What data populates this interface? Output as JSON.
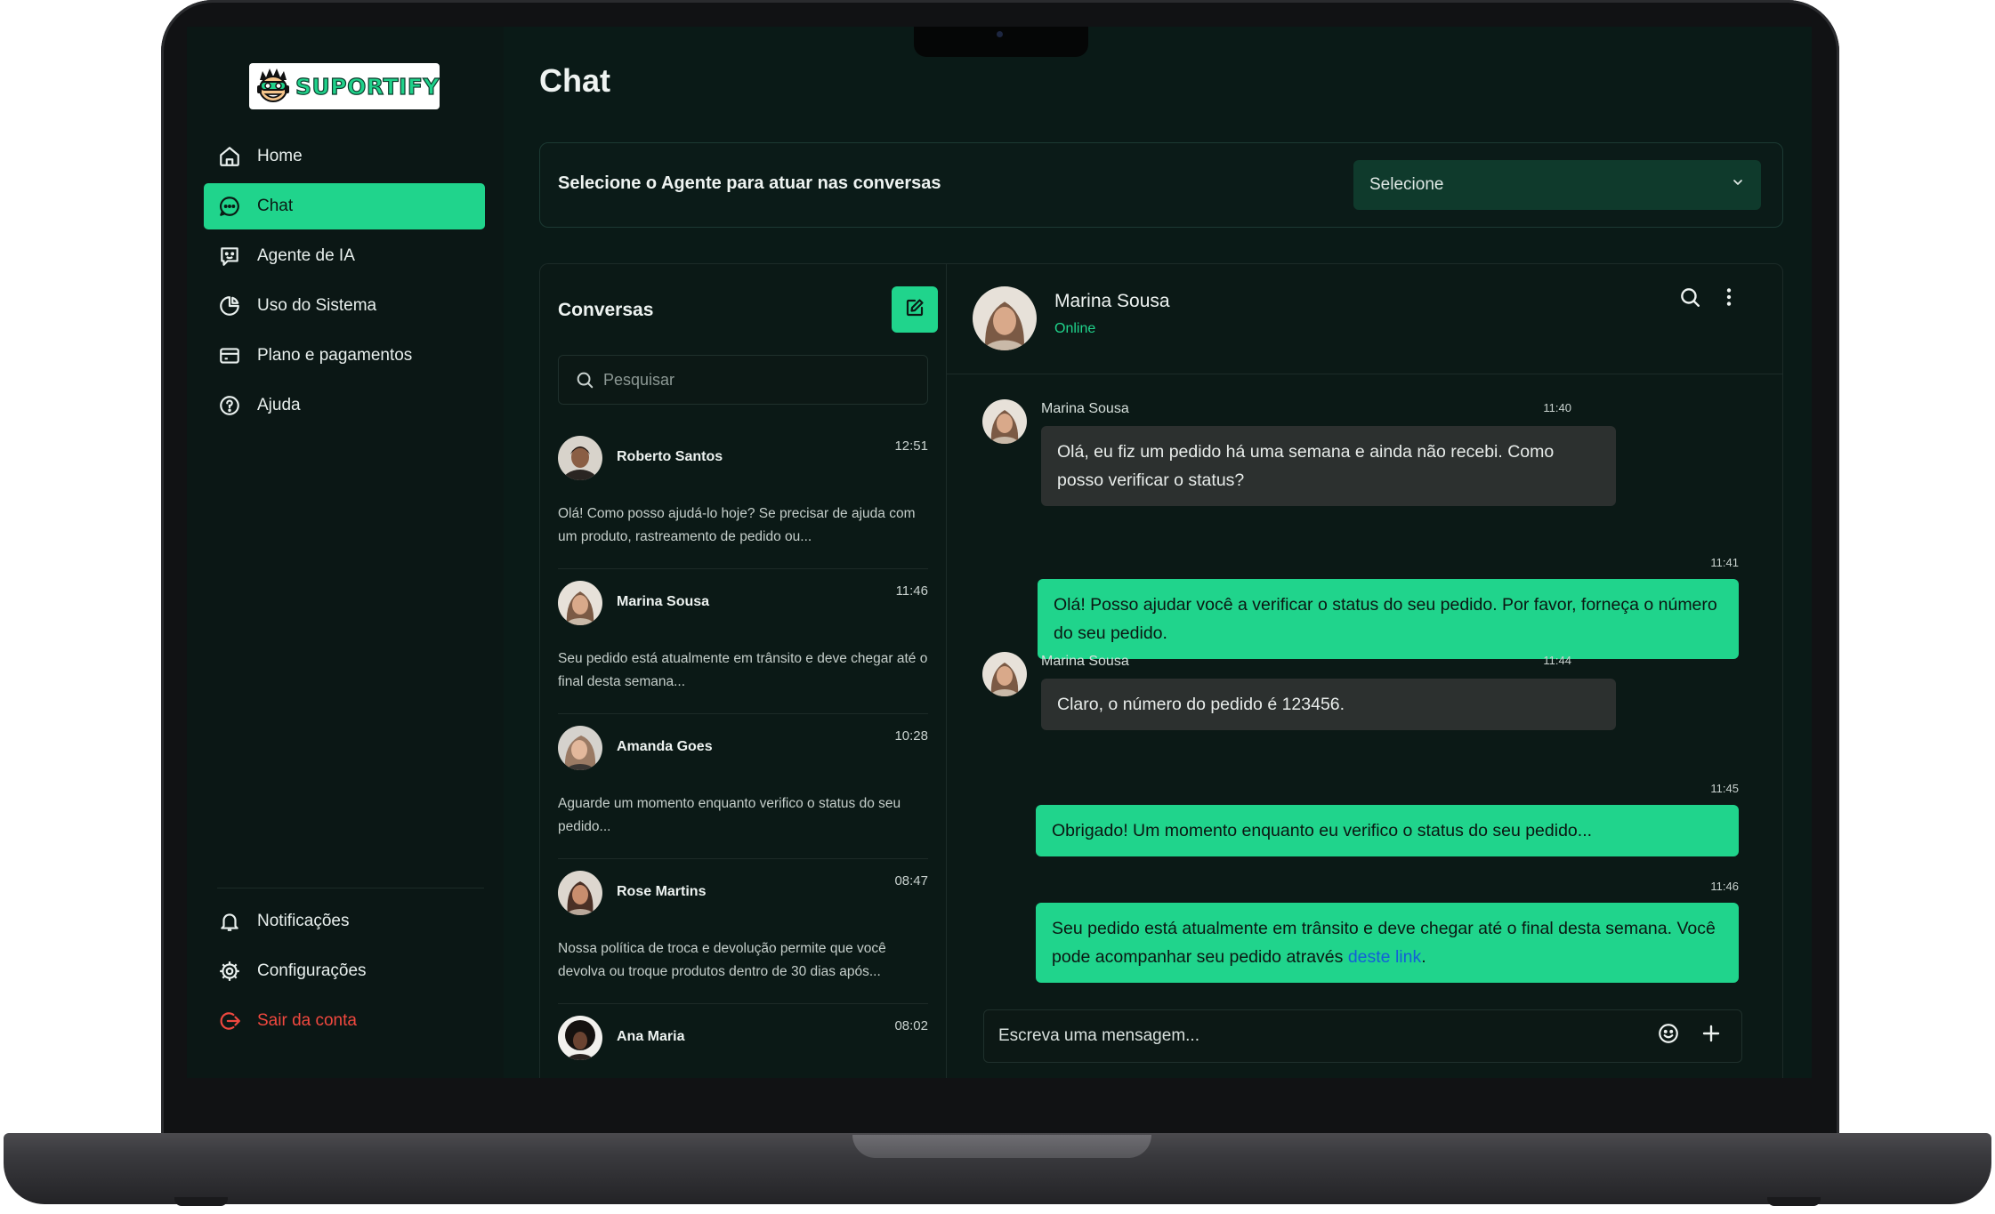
{
  "colors": {
    "accent": "#20d48c",
    "background": "#0a1a17",
    "logout": "#f0483f",
    "link": "#1260d8"
  },
  "logo": {
    "text": "SUPORTIFY"
  },
  "sidebar": {
    "items": [
      {
        "label": "Home",
        "icon": "home-icon"
      },
      {
        "label": "Chat",
        "icon": "chat-icon",
        "active": true
      },
      {
        "label": "Agente de IA",
        "icon": "bot-icon"
      },
      {
        "label": "Uso do Sistema",
        "icon": "pie-chart-icon"
      },
      {
        "label": "Plano e pagamentos",
        "icon": "credit-card-icon"
      },
      {
        "label": "Ajuda",
        "icon": "help-icon"
      }
    ],
    "bottom_items": [
      {
        "label": "Notificações",
        "icon": "bell-icon"
      },
      {
        "label": "Configurações",
        "icon": "gear-icon"
      },
      {
        "label": "Sair da conta",
        "icon": "logout-icon"
      }
    ]
  },
  "page": {
    "title": "Chat"
  },
  "agent": {
    "label": "Selecione o Agente para atuar nas conversas",
    "select_value": "Selecione"
  },
  "conversations": {
    "title": "Conversas",
    "search_placeholder": "Pesquisar",
    "items": [
      {
        "name": "Roberto Santos",
        "time": "12:51",
        "preview": "Olá! Como posso ajudá-lo hoje? Se precisar de ajuda com um produto, rastreamento de pedido ou..."
      },
      {
        "name": "Marina Sousa",
        "time": "11:46",
        "preview": "Seu pedido está atualmente em trânsito e deve chegar até o final desta semana..."
      },
      {
        "name": "Amanda Goes",
        "time": "10:28",
        "preview": "Aguarde um momento enquanto verifico o status do seu pedido..."
      },
      {
        "name": "Rose Martins",
        "time": "08:47",
        "preview": "Nossa política de troca e devolução permite que você devolva ou troque produtos dentro de 30 dias após..."
      },
      {
        "name": "Ana Maria",
        "time": "08:02",
        "preview": ""
      }
    ]
  },
  "chat": {
    "contact_name": "Marina Sousa",
    "contact_status": "Online",
    "messages": [
      {
        "direction": "in",
        "sender": "Marina Sousa",
        "time": "11:40",
        "text": "Olá, eu fiz um pedido há uma semana e ainda não recebi. Como posso verificar o status?"
      },
      {
        "direction": "out",
        "time": "11:41",
        "text": "Olá! Posso ajudar você a verificar o status do seu pedido. Por favor, forneça o número do seu pedido."
      },
      {
        "direction": "in",
        "sender": "Marina Sousa",
        "time": "11:44",
        "text": "Claro, o número do pedido é 123456."
      },
      {
        "direction": "out",
        "time": "11:45",
        "text": "Obrigado! Um momento enquanto eu verifico o status do seu pedido..."
      },
      {
        "direction": "out",
        "time": "11:46",
        "text": "Seu pedido está atualmente em trânsito e deve chegar até o final desta semana. Você pode acompanhar seu pedido através ",
        "link_text": "deste link",
        "text_after": "."
      }
    ],
    "composer_placeholder": "Escreva uma mensagem..."
  }
}
